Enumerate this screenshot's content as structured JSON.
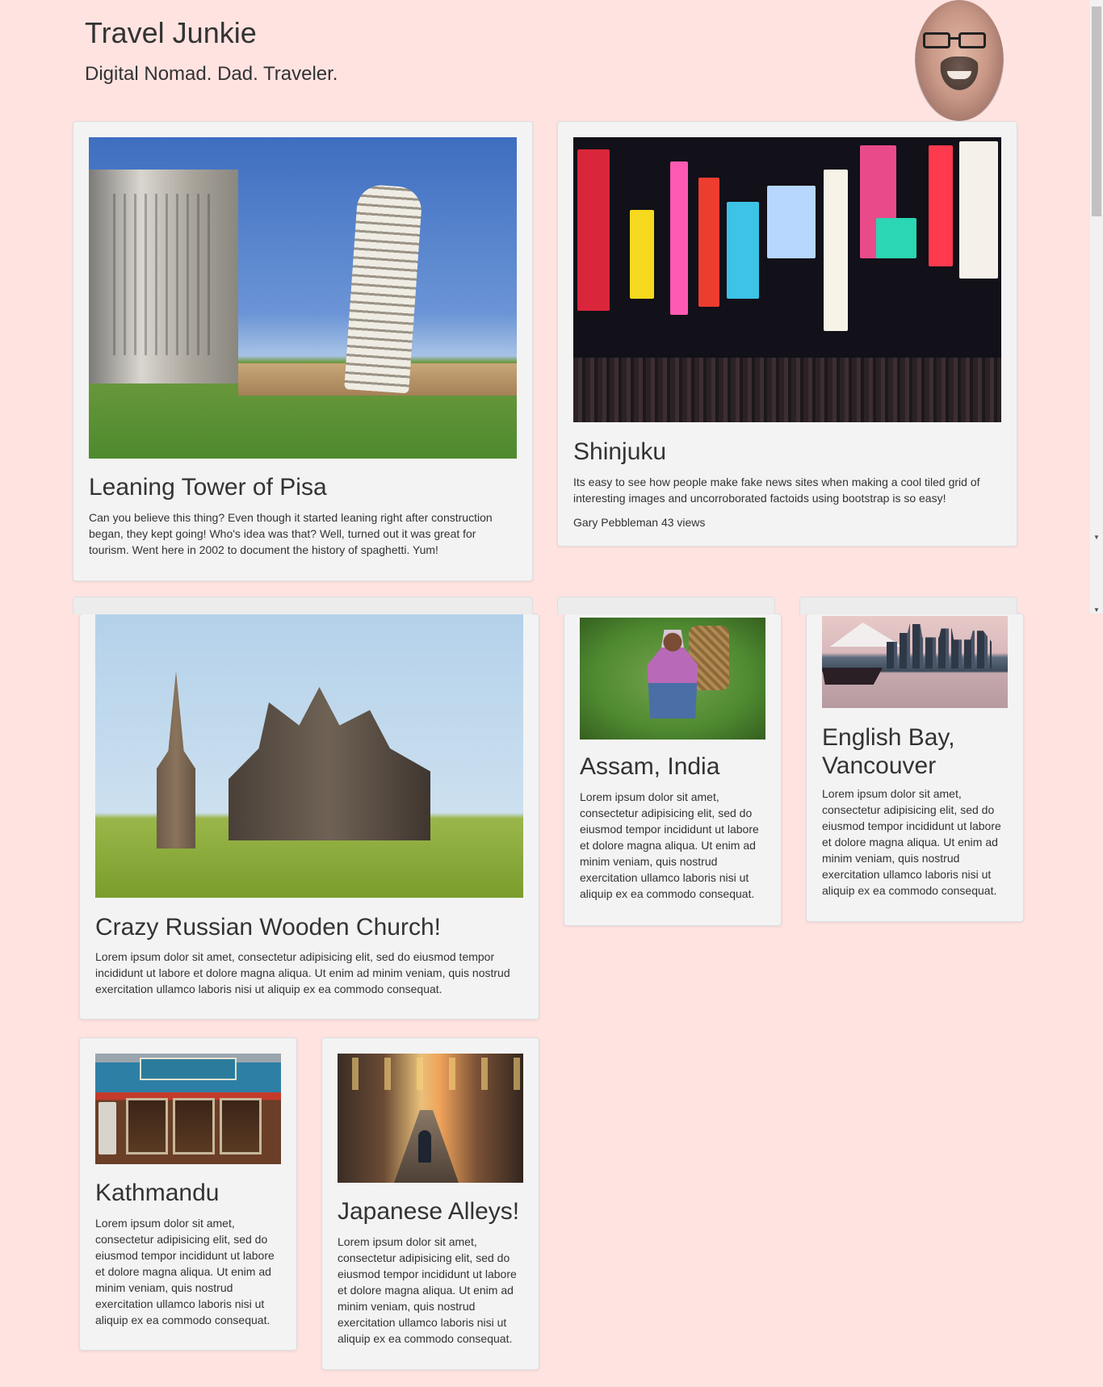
{
  "site": {
    "title": "Travel Junkie",
    "tagline": "Digital Nomad. Dad. Traveler."
  },
  "cards": {
    "pisa": {
      "title": "Leaning Tower of Pisa",
      "text": "Can you believe this thing? Even though it started leaning right after construction began, they kept going! Who's idea was that? Well, turned out it was great for tourism. Went here in 2002 to document the history of spaghetti. Yum!"
    },
    "shinjuku": {
      "title": "Shinjuku",
      "text": "Its easy to see how people make fake news sites when making a cool tiled grid of interesting images and uncorroborated factoids using bootstrap is so easy!",
      "meta": "Gary Pebbleman 43 views"
    },
    "church": {
      "title": "Crazy Russian Wooden Church!",
      "text": "Lorem ipsum dolor sit amet, consectetur adipisicing elit, sed do eiusmod tempor incididunt ut labore et dolore magna aliqua. Ut enim ad minim veniam, quis nostrud exercitation ullamco laboris nisi ut aliquip ex ea commodo consequat."
    },
    "assam": {
      "title": "Assam, India",
      "text": "Lorem ipsum dolor sit amet, consectetur adipisicing elit, sed do eiusmod tempor incididunt ut labore et dolore magna aliqua. Ut enim ad minim veniam, quis nostrud exercitation ullamco laboris nisi ut aliquip ex ea commodo consequat."
    },
    "vancouver": {
      "title": "English Bay, Vancouver",
      "text": "Lorem ipsum dolor sit amet, consectetur adipisicing elit, sed do eiusmod tempor incididunt ut labore et dolore magna aliqua. Ut enim ad minim veniam, quis nostrud exercitation ullamco laboris nisi ut aliquip ex ea commodo consequat."
    },
    "kathmandu": {
      "title": "Kathmandu",
      "text": "Lorem ipsum dolor sit amet, consectetur adipisicing elit, sed do eiusmod tempor incididunt ut labore et dolore magna aliqua. Ut enim ad minim veniam, quis nostrud exercitation ullamco laboris nisi ut aliquip ex ea commodo consequat."
    },
    "alleys": {
      "title": "Japanese Alleys!",
      "text": "Lorem ipsum dolor sit amet, consectetur adipisicing elit, sed do eiusmod tempor incididunt ut labore et dolore magna aliqua. Ut enim ad minim veniam, quis nostrud exercitation ullamco laboris nisi ut aliquip ex ea commodo consequat."
    }
  },
  "colors": {
    "page_background": "#ffe3e1",
    "card_background": "#f3f3f3",
    "text": "#333333"
  }
}
